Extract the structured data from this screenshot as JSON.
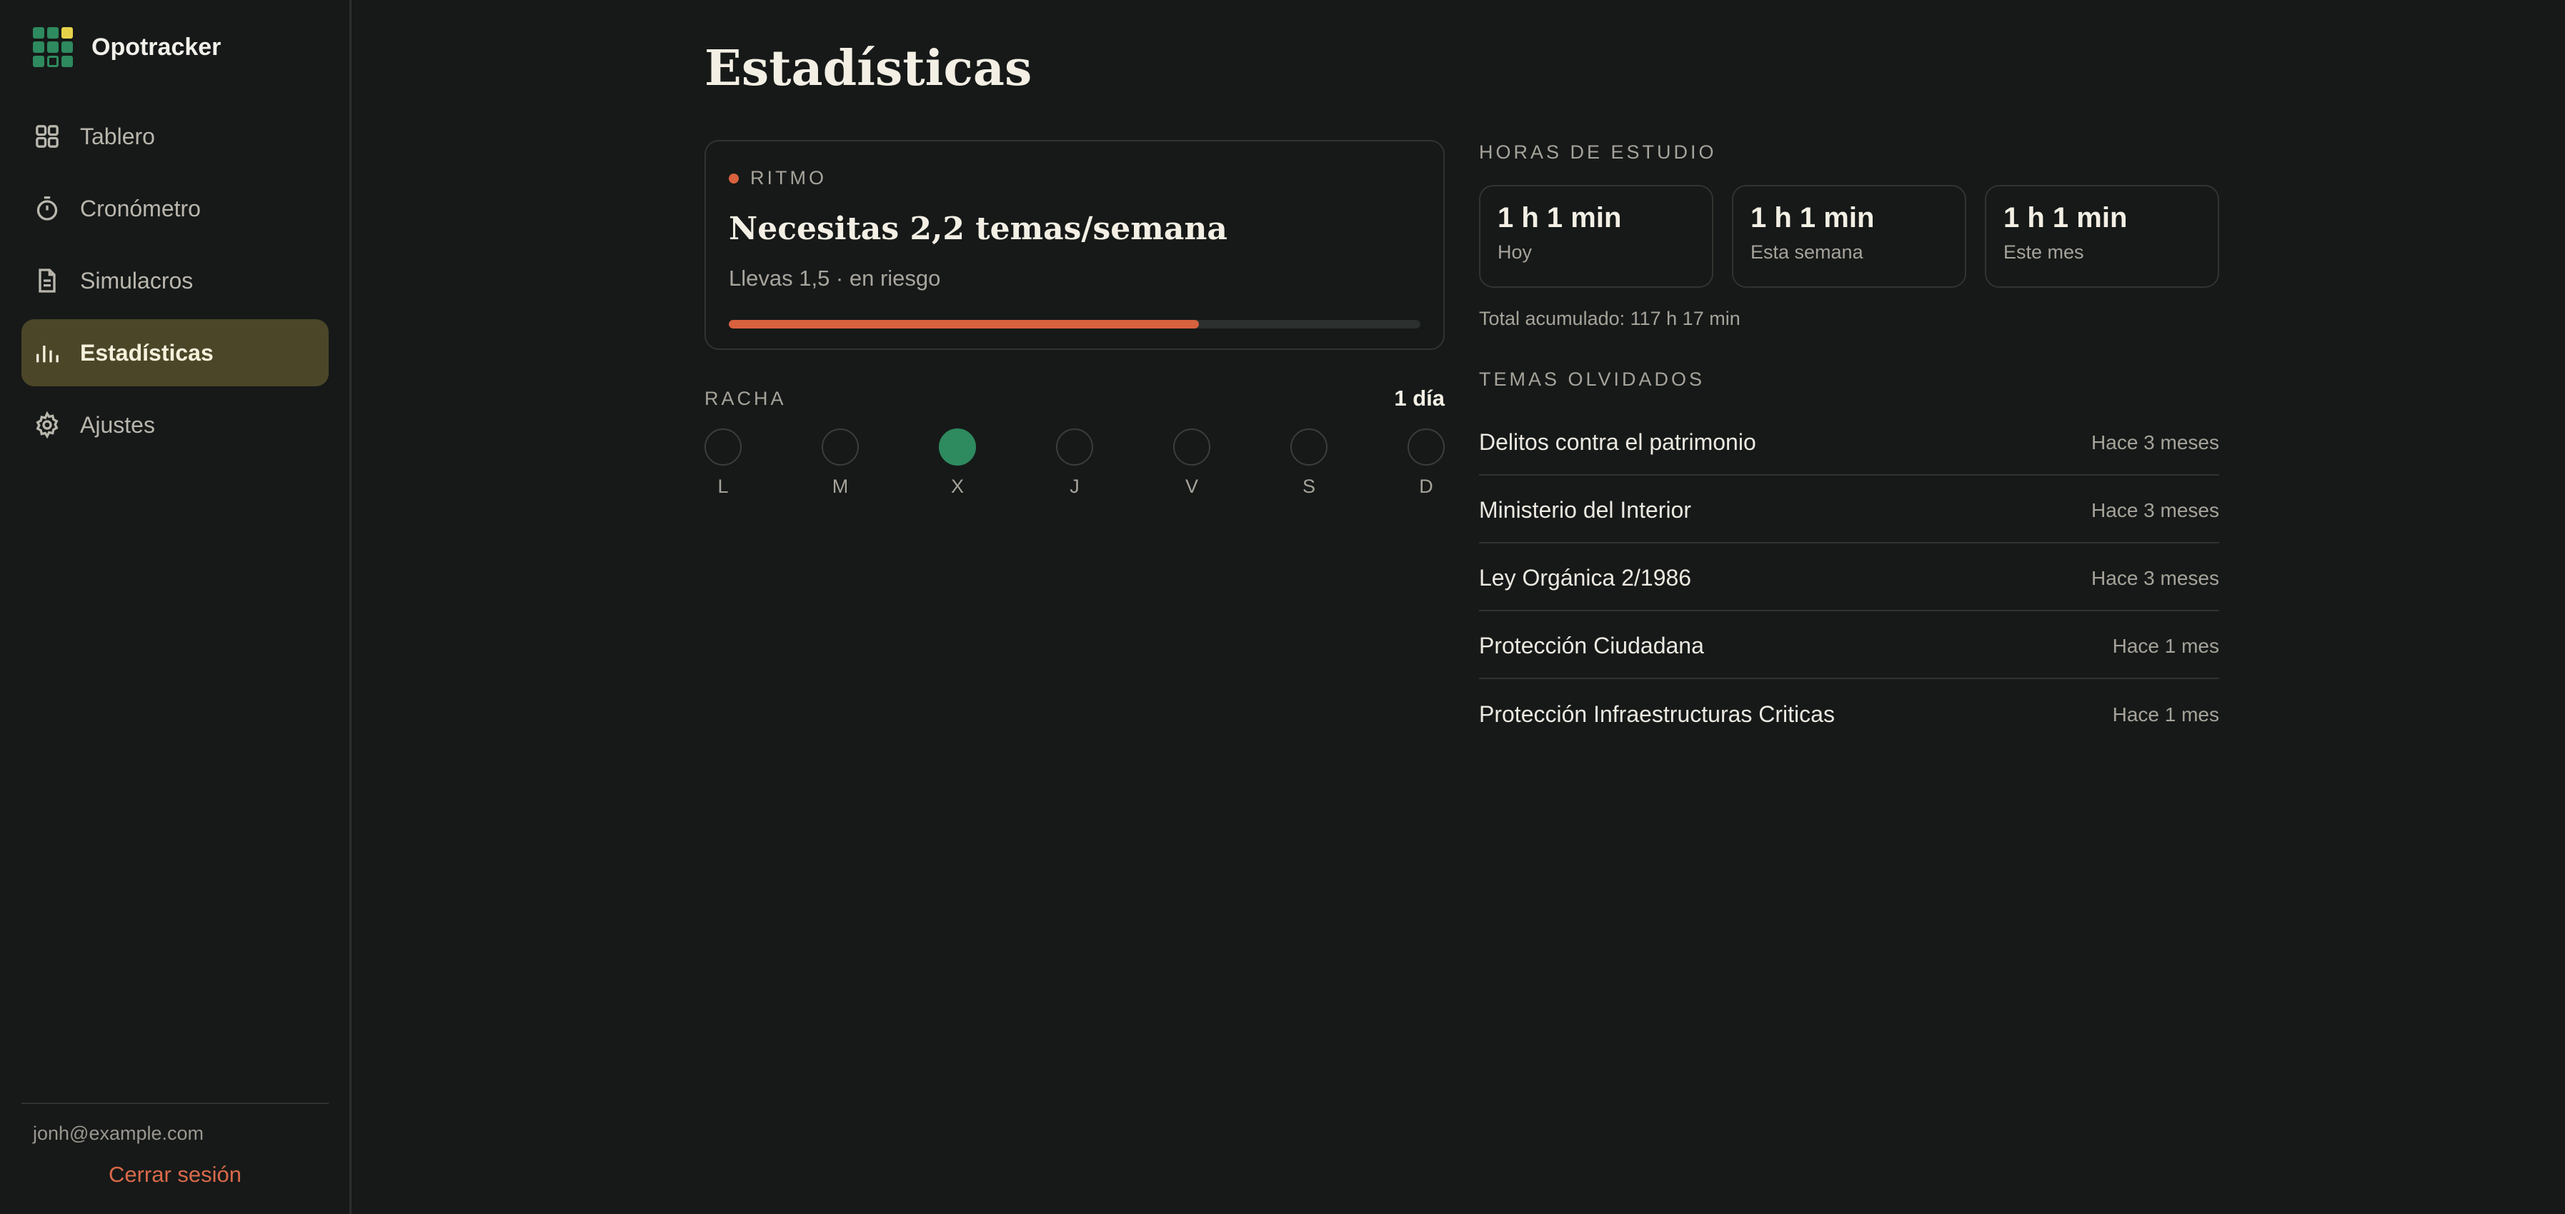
{
  "app": {
    "name": "Opotracker"
  },
  "sidebar": {
    "items": [
      {
        "label": "Tablero",
        "icon": "grid-icon",
        "active": false
      },
      {
        "label": "Cronómetro",
        "icon": "stopwatch-icon",
        "active": false
      },
      {
        "label": "Simulacros",
        "icon": "document-icon",
        "active": false
      },
      {
        "label": "Estadísticas",
        "icon": "bar-chart-icon",
        "active": true
      },
      {
        "label": "Ajustes",
        "icon": "gear-icon",
        "active": false
      }
    ],
    "user_email": "jonh@example.com",
    "logout_label": "Cerrar sesión"
  },
  "page": {
    "title": "Estadísticas"
  },
  "ritmo": {
    "label": "RITMO",
    "title": "Necesitas 2,2 temas/semana",
    "subtitle": "Llevas 1,5 · en riesgo",
    "progress": 0.68,
    "color": "#d8613e"
  },
  "racha": {
    "label": "RACHA",
    "count": "1 día",
    "days": [
      {
        "letter": "L",
        "done": false
      },
      {
        "letter": "M",
        "done": false
      },
      {
        "letter": "X",
        "done": true
      },
      {
        "letter": "J",
        "done": false
      },
      {
        "letter": "V",
        "done": false
      },
      {
        "letter": "S",
        "done": false
      },
      {
        "letter": "D",
        "done": false
      }
    ]
  },
  "horas": {
    "label": "HORAS DE ESTUDIO",
    "stats": [
      {
        "value": "1 h 1 min",
        "caption": "Hoy"
      },
      {
        "value": "1 h 1 min",
        "caption": "Esta semana"
      },
      {
        "value": "1 h 1 min",
        "caption": "Este mes"
      }
    ],
    "total": "Total acumulado: 117 h 17 min"
  },
  "temas": {
    "label": "TEMAS OLVIDADOS",
    "items": [
      {
        "name": "Delitos contra el patrimonio",
        "time": "Hace 3 meses"
      },
      {
        "name": "Ministerio del Interior",
        "time": "Hace 3 meses"
      },
      {
        "name": "Ley Orgánica 2/1986",
        "time": "Hace 3 meses"
      },
      {
        "name": "Protección Ciudadana",
        "time": "Hace 1 mes"
      },
      {
        "name": "Protección Infraestructuras Criticas",
        "time": "Hace 1 mes"
      }
    ]
  }
}
